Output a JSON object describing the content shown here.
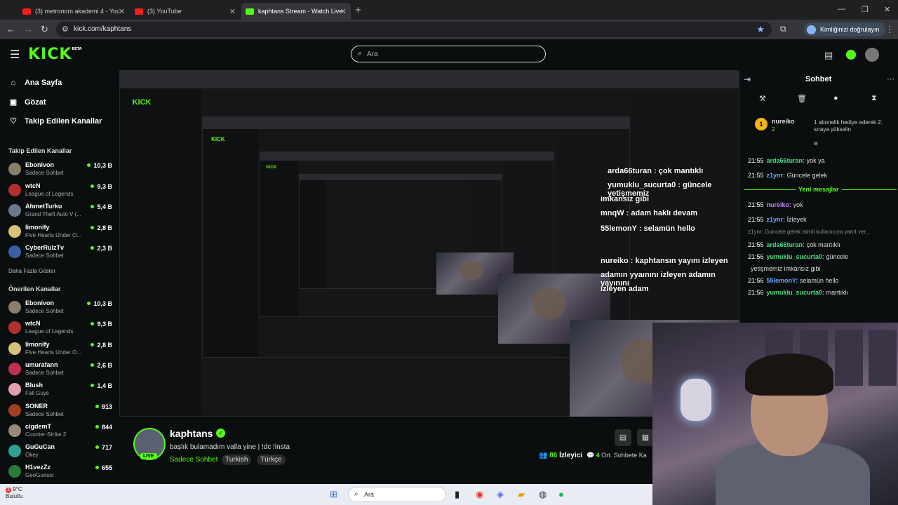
{
  "browser": {
    "tabs": [
      {
        "title": "(3) metronom akademi 4 - YouTube"
      },
      {
        "title": "(3) YouTube"
      },
      {
        "title": "kaphtans Stream - Watch Live on Kick"
      }
    ],
    "url": "kick.com/kaphtans",
    "profile_label": "Kimliğinizi doğrulayın"
  },
  "kick": {
    "logo": "KICK",
    "logo_badge": "BETA",
    "search_placeholder": "Ara"
  },
  "sidebar": {
    "nav": [
      {
        "label": "Ana Sayfa",
        "icon": "home-icon"
      },
      {
        "label": "Gözat",
        "icon": "browse-icon"
      },
      {
        "label": "Takip Edilen Kanallar",
        "icon": "heart-icon"
      }
    ],
    "following_title": "Takip Edilen Kanallar",
    "following": [
      {
        "name": "Ebonivon",
        "category": "Sadece Sohbet",
        "viewers": "10,3 B",
        "color": "#8a7f6a"
      },
      {
        "name": "wtcN",
        "category": "League of Legends",
        "viewers": "9,3 B",
        "color": "#b03030"
      },
      {
        "name": "AhmetTurku",
        "category": "Grand Theft Auto V (...",
        "viewers": "5,4 B",
        "color": "#6a7a8a"
      },
      {
        "name": "limonify",
        "category": "Five Hearts Under O...",
        "viewers": "2,8 B",
        "color": "#d8c27a"
      },
      {
        "name": "CyberRulzTv",
        "category": "Sadece Sohbet",
        "viewers": "2,3 B",
        "color": "#3a5fa0"
      }
    ],
    "show_more": "Daha Fazla Göster",
    "recommended_title": "Önerilen Kanallar",
    "recommended": [
      {
        "name": "Ebonivon",
        "category": "Sadece Sohbet",
        "viewers": "10,3 B",
        "color": "#8a7f6a"
      },
      {
        "name": "wtcN",
        "category": "League of Legends",
        "viewers": "9,3 B",
        "color": "#b03030"
      },
      {
        "name": "limonify",
        "category": "Five Hearts Under O...",
        "viewers": "2,8 B",
        "color": "#d8c27a"
      },
      {
        "name": "umurafann",
        "category": "Sadece Sohbet",
        "viewers": "2,6 B",
        "color": "#c03050"
      },
      {
        "name": "Blush",
        "category": "Fall Guys",
        "viewers": "1,4 B",
        "color": "#e0a0b0"
      },
      {
        "name": "SONER",
        "category": "Sadece Sohbet",
        "viewers": "913",
        "color": "#a04020"
      },
      {
        "name": "cigdemT",
        "category": "Counter-Strike 2",
        "viewers": "844",
        "color": "#9a8a7a"
      },
      {
        "name": "GuGuCan",
        "category": "Okey",
        "viewers": "717",
        "color": "#30a090"
      },
      {
        "name": "H1vezZz",
        "category": "GeoGuessr",
        "viewers": "655",
        "color": "#2a7a3a"
      }
    ]
  },
  "stream": {
    "name": "kaphtans",
    "title": "başlık bulamadım valla yine | !dc !insta",
    "category": "Sadece Sohbet",
    "tags": [
      "Turkish",
      "Türkçe"
    ],
    "live_label": "LIVE",
    "viewers": "86",
    "viewers_label": "İzleyici",
    "avg_time": "4",
    "avg_time_label": "Ort. Sohbete Ka"
  },
  "overlay": {
    "lines": [
      "arda66turan : çok mantıklı",
      "yumuklu_sucurta0 : güncele yetişmemiz",
      "imkansız gibi",
      "mnqW : adam haklı devam",
      "55lemonY : selamün hello",
      "nureiko : kaphtansın yayını izleyen",
      "adamın yyaınını izleyen adamın yayınını",
      "izleyen adam"
    ]
  },
  "chat": {
    "title": "Sohbet",
    "gift": {
      "user": "nureiko",
      "count": "2",
      "desc": "1 abonelik hediye ederek 2. sıraya yükselin"
    },
    "messages": [
      {
        "time": "21:55",
        "user": "arda66turan",
        "text": "yok ya",
        "cls": "u1"
      },
      {
        "time": "21:55",
        "user": "z1ynr",
        "text": "Guncele gelek",
        "cls": "u2"
      }
    ],
    "new_messages_label": "Yeni mesajlar",
    "messages2": [
      {
        "time": "21:55",
        "user": "nureiko",
        "text": "yok",
        "cls": "u3"
      },
      {
        "time": "21:55",
        "user": "z1ynr",
        "text": "İzleyek",
        "cls": "u2"
      }
    ],
    "reply_preview": "z1ynr: Guncele gelek isimli kullanıcıya yanıt ver...",
    "messages3": [
      {
        "time": "21:55",
        "user": "arda66turan",
        "text": "çok mantıklı",
        "cls": "u1"
      },
      {
        "time": "21:56",
        "user": "yumuklu_sucurta0",
        "text": "güncele",
        "cls": "u1"
      },
      {
        "time": "",
        "user": "",
        "text": "yetişmemiz imkansız gibi",
        "cls": "u1"
      },
      {
        "time": "21:56",
        "user": "55lemonY",
        "text": "selamün hello",
        "cls": "u2"
      },
      {
        "time": "21:56",
        "user": "yumuklu_sucurta0",
        "text": "mantıklı",
        "cls": "u1"
      }
    ]
  },
  "taskbar": {
    "temp": "9°C",
    "weather": "Bulutlu",
    "badge": "2",
    "search_placeholder": "Ara"
  }
}
